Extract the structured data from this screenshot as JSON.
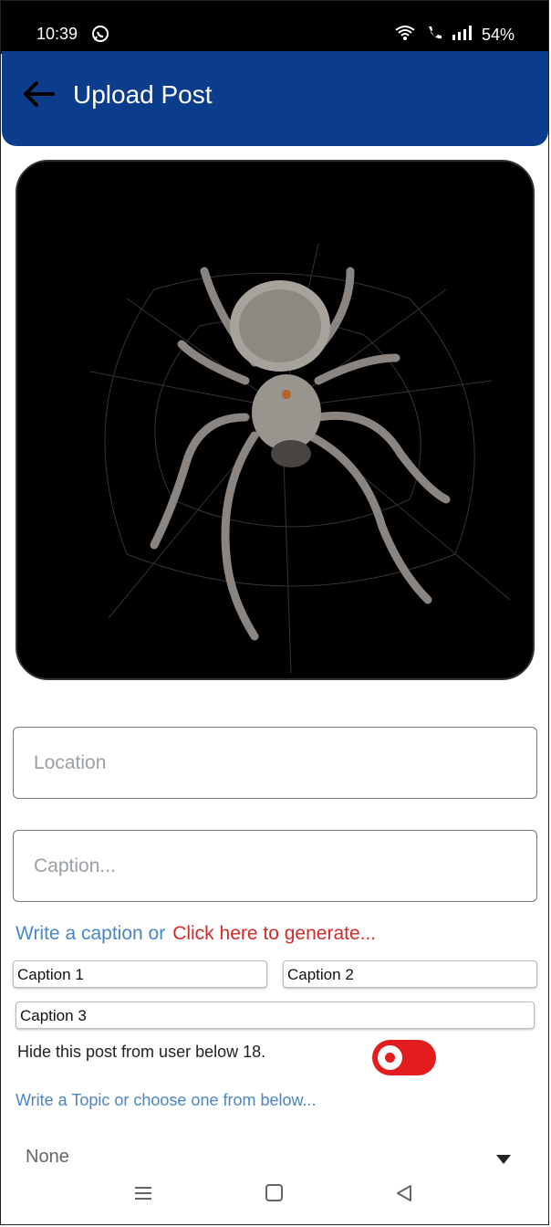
{
  "status_bar": {
    "time": "10:39",
    "battery": "54%"
  },
  "appbar": {
    "title": "Upload Post"
  },
  "form": {
    "location_placeholder": "Location",
    "caption_placeholder": "Caption...",
    "hint_prefix": "Write a caption or",
    "generate_link": "Click here to generate...",
    "captions": [
      "Caption 1",
      "Caption 2",
      "Caption 3"
    ],
    "hide_label": "Hide this post from user below 18.",
    "hide_toggle_on": true,
    "topic_hint": "Write a Topic or choose one from below...",
    "topic_selected": "None"
  },
  "colors": {
    "appbar": "#0c3d8d",
    "accent_red": "#e31d1d",
    "hint_blue": "#4a86c5"
  }
}
